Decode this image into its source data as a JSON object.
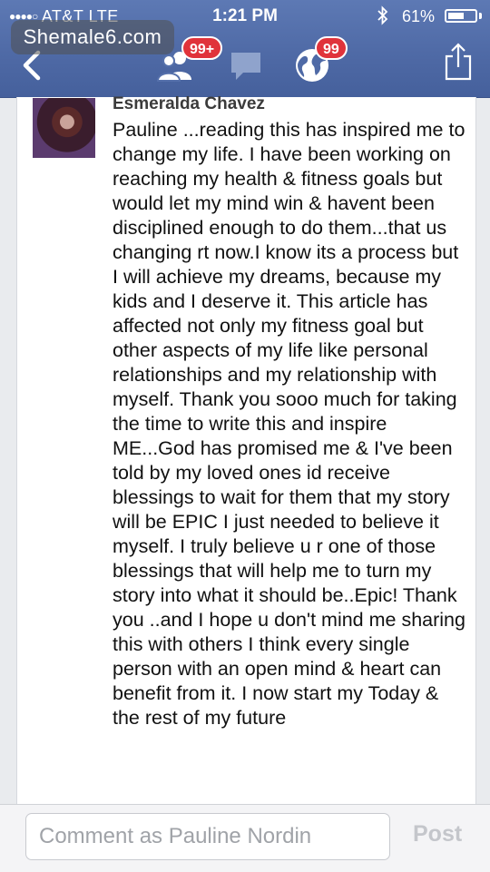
{
  "status_bar": {
    "signal_dots": "●●●●○",
    "carrier": "AT&T",
    "network": "LTE",
    "time": "1:21 PM",
    "battery_percent": "61%",
    "battery_level": 0.61
  },
  "watermark": {
    "text": "Shemale6.com"
  },
  "nav": {
    "friends_badge": "99+",
    "notifications_badge": "99"
  },
  "comment": {
    "author": "Esmeralda Chavez",
    "text": "Pauline ...reading this has inspired me to change my life. I have been working on reaching my health & fitness goals but would let my mind win & havent been disciplined enough to do them...that us changing rt now.I know its a process but I will achieve my dreams, because my kids and I deserve it. This article has affected not only my fitness goal but other aspects of my life like personal relationships and my relationship with myself.  Thank you sooo much for taking the time to write this and inspire ME...God has promised me & I've been told by my loved ones id receive blessings to wait for them that my story will be EPIC I just needed to believe it myself. I truly believe u r one of those blessings that will help me to turn my story into what it should be..Epic!  Thank you ..and I hope u don't mind me sharing this with others I think every single person with an open mind & heart can benefit from it. I now start my Today & the rest of my future"
  },
  "composer": {
    "placeholder": "Comment as Pauline Nordin",
    "post_label": "Post"
  }
}
